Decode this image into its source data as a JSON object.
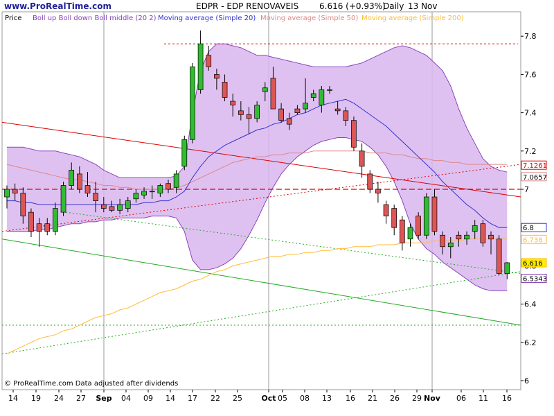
{
  "site": {
    "url": "www.ProRealTime.com",
    "footer": "© ProRealTime.com  Data adjusted after dividends"
  },
  "header": {
    "symbol": "EDPR - EDP RENOVAVEIS",
    "price_change": "6.616 (+0.93%)",
    "period": "Daily",
    "date": "13 Nov"
  },
  "legend": {
    "price": "Price",
    "boll": "Boll up Boll down Boll middle (20 2)",
    "ma20": "Moving average (Simple 20)",
    "ma50": "Moving average (Simple 50)",
    "ma200": "Moving average (Simple 200)"
  },
  "colors": {
    "up": "#33bb33",
    "down": "#dd5555",
    "band_fill": "#d9b6ee",
    "band_edge": "#8844bb",
    "ma20": "#3333cc",
    "ma50": "#dd8888",
    "ma200": "#ffbb33",
    "level_red": "#dd0000",
    "trend_green": "#22aa22",
    "grid": "#999999"
  },
  "chart_data": {
    "type": "candlestick",
    "title": "EDPR - EDP RENOVAVEIS",
    "period": "Daily",
    "ylim": [
      6.0,
      7.9
    ],
    "x_tick_labels": [
      "14",
      "19",
      "24",
      "27",
      "Sep",
      "04",
      "09",
      "14",
      "17",
      "22",
      "25",
      "Oct",
      "05",
      "08",
      "13",
      "16",
      "21",
      "26",
      "29",
      "Nov",
      "06",
      "11",
      "16"
    ],
    "y_tick_labels": [
      "6",
      "6.2",
      "6.4",
      "6.6",
      "6.8",
      "7",
      "7.2",
      "7.4",
      "7.6",
      "7.8"
    ],
    "candles": [
      {
        "o": 6.96,
        "h": 7.02,
        "l": 6.9,
        "c": 7.0
      },
      {
        "o": 7.0,
        "h": 7.03,
        "l": 6.94,
        "c": 6.98
      },
      {
        "o": 6.98,
        "h": 7.01,
        "l": 6.82,
        "c": 6.86
      },
      {
        "o": 6.88,
        "h": 6.9,
        "l": 6.75,
        "c": 6.78
      },
      {
        "o": 6.82,
        "h": 6.85,
        "l": 6.7,
        "c": 6.78
      },
      {
        "o": 6.82,
        "h": 6.85,
        "l": 6.76,
        "c": 6.78
      },
      {
        "o": 6.78,
        "h": 6.93,
        "l": 6.76,
        "c": 6.9
      },
      {
        "o": 6.88,
        "h": 7.04,
        "l": 6.86,
        "c": 7.02
      },
      {
        "o": 7.02,
        "h": 7.14,
        "l": 7.0,
        "c": 7.1
      },
      {
        "o": 7.08,
        "h": 7.12,
        "l": 6.98,
        "c": 7.0
      },
      {
        "o": 7.02,
        "h": 7.09,
        "l": 6.96,
        "c": 6.98
      },
      {
        "o": 6.98,
        "h": 7.04,
        "l": 6.88,
        "c": 6.94
      },
      {
        "o": 6.92,
        "h": 6.96,
        "l": 6.88,
        "c": 6.9
      },
      {
        "o": 6.91,
        "h": 6.94,
        "l": 6.88,
        "c": 6.89
      },
      {
        "o": 6.89,
        "h": 6.95,
        "l": 6.87,
        "c": 6.92
      },
      {
        "o": 6.9,
        "h": 6.96,
        "l": 6.88,
        "c": 6.94
      },
      {
        "o": 6.95,
        "h": 7.0,
        "l": 6.93,
        "c": 6.98
      },
      {
        "o": 6.97,
        "h": 7.01,
        "l": 6.95,
        "c": 6.99
      },
      {
        "o": 6.99,
        "h": 7.02,
        "l": 6.95,
        "c": 6.99
      },
      {
        "o": 6.98,
        "h": 7.03,
        "l": 6.96,
        "c": 7.02
      },
      {
        "o": 7.03,
        "h": 7.05,
        "l": 6.98,
        "c": 7.0
      },
      {
        "o": 7.01,
        "h": 7.1,
        "l": 6.98,
        "c": 7.08
      },
      {
        "o": 7.12,
        "h": 7.28,
        "l": 7.1,
        "c": 7.26
      },
      {
        "o": 7.26,
        "h": 7.66,
        "l": 7.24,
        "c": 7.64
      },
      {
        "o": 7.52,
        "h": 7.83,
        "l": 7.5,
        "c": 7.76
      },
      {
        "o": 7.7,
        "h": 7.75,
        "l": 7.62,
        "c": 7.64
      },
      {
        "o": 7.6,
        "h": 7.63,
        "l": 7.52,
        "c": 7.58
      },
      {
        "o": 7.56,
        "h": 7.6,
        "l": 7.46,
        "c": 7.48
      },
      {
        "o": 7.46,
        "h": 7.5,
        "l": 7.38,
        "c": 7.44
      },
      {
        "o": 7.41,
        "h": 7.46,
        "l": 7.36,
        "c": 7.39
      },
      {
        "o": 7.39,
        "h": 7.43,
        "l": 7.29,
        "c": 7.37
      },
      {
        "o": 7.37,
        "h": 7.46,
        "l": 7.35,
        "c": 7.44
      },
      {
        "o": 7.51,
        "h": 7.56,
        "l": 7.46,
        "c": 7.53
      },
      {
        "o": 7.58,
        "h": 7.64,
        "l": 7.42,
        "c": 7.42
      },
      {
        "o": 7.42,
        "h": 7.45,
        "l": 7.35,
        "c": 7.36
      },
      {
        "o": 7.37,
        "h": 7.4,
        "l": 7.31,
        "c": 7.34
      },
      {
        "o": 7.42,
        "h": 7.44,
        "l": 7.39,
        "c": 7.4
      },
      {
        "o": 7.42,
        "h": 7.58,
        "l": 7.4,
        "c": 7.45
      },
      {
        "o": 7.48,
        "h": 7.52,
        "l": 7.46,
        "c": 7.5
      },
      {
        "o": 7.44,
        "h": 7.54,
        "l": 7.4,
        "c": 7.52
      },
      {
        "o": 7.52,
        "h": 7.54,
        "l": 7.5,
        "c": 7.52
      },
      {
        "o": 7.42,
        "h": 7.46,
        "l": 7.39,
        "c": 7.41
      },
      {
        "o": 7.41,
        "h": 7.43,
        "l": 7.33,
        "c": 7.36
      },
      {
        "o": 7.36,
        "h": 7.38,
        "l": 7.2,
        "c": 7.22
      },
      {
        "o": 7.2,
        "h": 7.24,
        "l": 7.06,
        "c": 7.12
      },
      {
        "o": 7.08,
        "h": 7.1,
        "l": 6.98,
        "c": 7.0
      },
      {
        "o": 7.0,
        "h": 7.04,
        "l": 6.93,
        "c": 6.98
      },
      {
        "o": 6.92,
        "h": 6.94,
        "l": 6.82,
        "c": 6.86
      },
      {
        "o": 6.9,
        "h": 6.92,
        "l": 6.76,
        "c": 6.8
      },
      {
        "o": 6.84,
        "h": 6.86,
        "l": 6.68,
        "c": 6.72
      },
      {
        "o": 6.74,
        "h": 6.82,
        "l": 6.7,
        "c": 6.8
      },
      {
        "o": 6.86,
        "h": 6.88,
        "l": 6.74,
        "c": 6.76
      },
      {
        "o": 6.76,
        "h": 6.98,
        "l": 6.74,
        "c": 6.96
      },
      {
        "o": 6.96,
        "h": 7.0,
        "l": 6.76,
        "c": 6.78
      },
      {
        "o": 6.76,
        "h": 6.78,
        "l": 6.66,
        "c": 6.7
      },
      {
        "o": 6.7,
        "h": 6.75,
        "l": 6.64,
        "c": 6.72
      },
      {
        "o": 6.76,
        "h": 6.78,
        "l": 6.7,
        "c": 6.74
      },
      {
        "o": 6.74,
        "h": 6.78,
        "l": 6.71,
        "c": 6.76
      },
      {
        "o": 6.78,
        "h": 6.84,
        "l": 6.74,
        "c": 6.81
      },
      {
        "o": 6.82,
        "h": 6.84,
        "l": 6.7,
        "c": 6.72
      },
      {
        "o": 6.76,
        "h": 6.78,
        "l": 6.66,
        "c": 6.74
      },
      {
        "o": 6.74,
        "h": 6.76,
        "l": 6.55,
        "c": 6.56
      },
      {
        "o": 6.56,
        "h": 6.62,
        "l": 6.53,
        "c": 6.616
      }
    ],
    "bollinger_upper": [
      7.22,
      7.22,
      7.22,
      7.21,
      7.2,
      7.2,
      7.2,
      7.19,
      7.18,
      7.17,
      7.15,
      7.13,
      7.1,
      7.08,
      7.06,
      7.06,
      7.06,
      7.06,
      7.06,
      7.06,
      7.06,
      7.07,
      7.12,
      7.4,
      7.62,
      7.72,
      7.76,
      7.76,
      7.75,
      7.74,
      7.72,
      7.7,
      7.7,
      7.69,
      7.68,
      7.67,
      7.66,
      7.65,
      7.64,
      7.64,
      7.64,
      7.64,
      7.64,
      7.65,
      7.66,
      7.68,
      7.7,
      7.72,
      7.74,
      7.75,
      7.74,
      7.72,
      7.7,
      7.66,
      7.62,
      7.54,
      7.42,
      7.32,
      7.24,
      7.16,
      7.12,
      7.1,
      7.09
    ],
    "bollinger_lower": [
      6.78,
      6.78,
      6.78,
      6.78,
      6.79,
      6.79,
      6.8,
      6.81,
      6.82,
      6.82,
      6.83,
      6.83,
      6.84,
      6.84,
      6.85,
      6.85,
      6.85,
      6.85,
      6.86,
      6.86,
      6.86,
      6.85,
      6.78,
      6.63,
      6.58,
      6.58,
      6.59,
      6.61,
      6.64,
      6.69,
      6.76,
      6.84,
      6.93,
      7.01,
      7.08,
      7.13,
      7.17,
      7.2,
      7.23,
      7.25,
      7.26,
      7.27,
      7.27,
      7.26,
      7.25,
      7.22,
      7.18,
      7.12,
      7.04,
      6.94,
      6.82,
      6.74,
      6.69,
      6.66,
      6.62,
      6.59,
      6.56,
      6.53,
      6.5,
      6.48,
      6.47,
      6.47,
      6.47
    ],
    "ma20": [
      6.94,
      6.94,
      6.93,
      6.93,
      6.92,
      6.92,
      6.92,
      6.92,
      6.92,
      6.92,
      6.92,
      6.92,
      6.92,
      6.92,
      6.92,
      6.92,
      6.92,
      6.93,
      6.93,
      6.94,
      6.94,
      6.96,
      6.99,
      7.06,
      7.12,
      7.17,
      7.2,
      7.23,
      7.25,
      7.27,
      7.29,
      7.31,
      7.32,
      7.34,
      7.35,
      7.37,
      7.39,
      7.4,
      7.42,
      7.44,
      7.45,
      7.46,
      7.47,
      7.45,
      7.42,
      7.39,
      7.36,
      7.33,
      7.29,
      7.25,
      7.21,
      7.17,
      7.13,
      7.09,
      7.04,
      7.0,
      6.96,
      6.92,
      6.89,
      6.85,
      6.82,
      6.8,
      6.8
    ],
    "ma50": [
      7.13,
      7.12,
      7.11,
      7.1,
      7.09,
      7.08,
      7.07,
      7.06,
      7.05,
      7.05,
      7.04,
      7.03,
      7.02,
      7.02,
      7.01,
      7.01,
      7.0,
      7.0,
      7.0,
      7.0,
      7.0,
      7.01,
      7.02,
      7.04,
      7.06,
      7.08,
      7.1,
      7.12,
      7.14,
      7.15,
      7.16,
      7.17,
      7.17,
      7.18,
      7.18,
      7.19,
      7.19,
      7.19,
      7.2,
      7.2,
      7.2,
      7.2,
      7.2,
      7.2,
      7.2,
      7.19,
      7.19,
      7.19,
      7.18,
      7.18,
      7.17,
      7.16,
      7.16,
      7.15,
      7.15,
      7.14,
      7.14,
      7.13,
      7.13,
      7.13,
      7.13,
      7.13,
      7.13
    ],
    "ma200": [
      6.14,
      6.16,
      6.18,
      6.2,
      6.22,
      6.23,
      6.24,
      6.26,
      6.27,
      6.29,
      6.31,
      6.33,
      6.34,
      6.35,
      6.37,
      6.38,
      6.4,
      6.42,
      6.44,
      6.46,
      6.47,
      6.48,
      6.5,
      6.52,
      6.53,
      6.55,
      6.57,
      6.58,
      6.6,
      6.61,
      6.62,
      6.63,
      6.64,
      6.65,
      6.65,
      6.66,
      6.66,
      6.67,
      6.67,
      6.68,
      6.68,
      6.69,
      6.69,
      6.7,
      6.7,
      6.7,
      6.71,
      6.71,
      6.71,
      6.72,
      6.72,
      6.72,
      6.72,
      6.73,
      6.73,
      6.73,
      6.73,
      6.74,
      6.74,
      6.74,
      6.74,
      6.74,
      6.74
    ],
    "axis_tags": [
      {
        "text": "7.1261",
        "value": 7.1261,
        "border": "#dd0000",
        "fill": "#ffffff",
        "color": "#dd0000"
      },
      {
        "text": "7.0657",
        "value": 7.0657,
        "border": "#dd8888",
        "fill": "#ffffff",
        "color": "#000000"
      },
      {
        "text": "6.8",
        "value": 6.8,
        "border": "#3333cc",
        "fill": "#ffffff",
        "color": "#000000"
      },
      {
        "text": "6.738",
        "value": 6.738,
        "border": "#ffbb33",
        "fill": "#ffffff",
        "color": "#ffbb33"
      },
      {
        "text": "6.616",
        "value": 6.616,
        "border": "#ffbb00",
        "fill": "#ffee00",
        "color": "#000000"
      },
      {
        "text": "6.5343",
        "value": 6.5343,
        "border": "#8844bb",
        "fill": "#ffffff",
        "color": "#000000"
      }
    ]
  }
}
